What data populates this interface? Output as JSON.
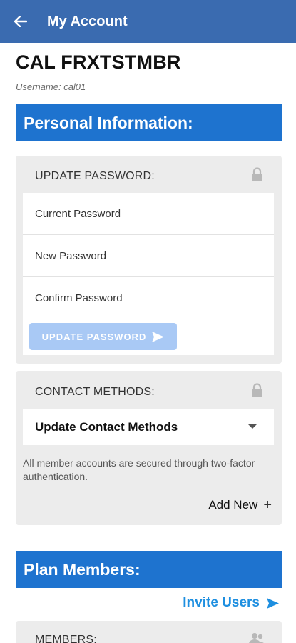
{
  "appbar": {
    "title": "My Account",
    "back_icon": "arrow-left-icon"
  },
  "account": {
    "name": "CAL FRXTSTMBR",
    "username": "Username: cal01"
  },
  "personal_section": {
    "title": "Personal Information:"
  },
  "password_card": {
    "heading": "UPDATE PASSWORD:",
    "fields": [
      {
        "placeholder": "Current Password"
      },
      {
        "placeholder": "New Password"
      },
      {
        "placeholder": "Confirm Password"
      }
    ],
    "button_label": "UPDATE PASSWORD"
  },
  "contact_card": {
    "heading": "CONTACT METHODS:",
    "select_value": "Update Contact Methods",
    "note": "All member accounts are secured through two-factor authentication.",
    "add_new_label": "Add New",
    "add_new_icon": "+"
  },
  "plan_section": {
    "title": "Plan Members:",
    "invite_label": "Invite Users"
  },
  "members_card": {
    "heading": "MEMBERS:"
  },
  "colors": {
    "appbar": "#3a6bb0",
    "banner": "#1e73cf",
    "link": "#1e8fe0",
    "button": "#a9c9f5"
  }
}
